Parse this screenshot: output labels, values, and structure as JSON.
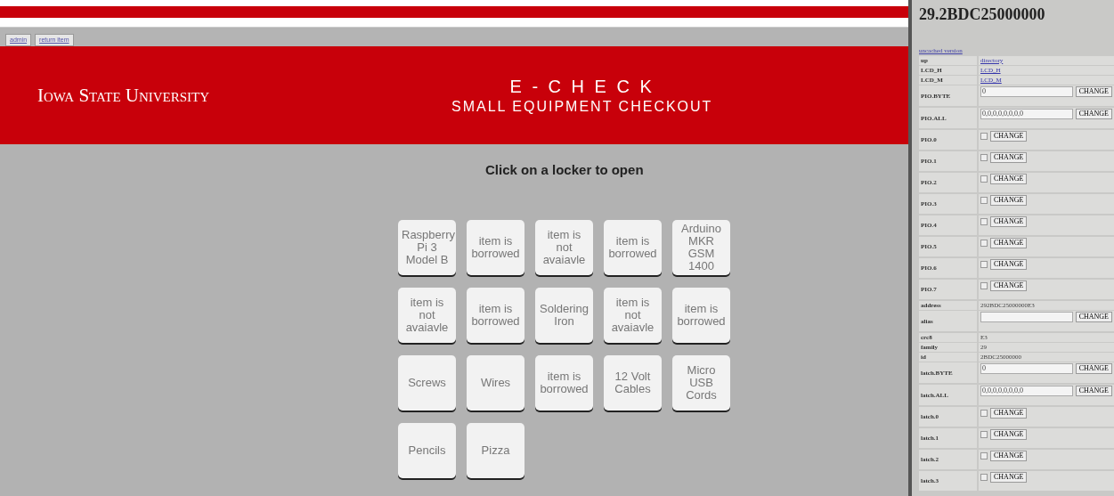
{
  "nav_tabs": [
    {
      "label": "admin"
    },
    {
      "label": "return item"
    }
  ],
  "header": {
    "logo": "Iowa State University",
    "title": "E - C H E C K",
    "subtitle": "SMALL EQUIPMENT CHECKOUT"
  },
  "instruction": "Click on a locker to open",
  "lockers": [
    {
      "label": "Raspberry Pi 3 Model B"
    },
    {
      "label": "item is borrowed"
    },
    {
      "label": "item is not avaiavle"
    },
    {
      "label": "item is borrowed"
    },
    {
      "label": "Arduino MKR GSM 1400"
    },
    {
      "label": "item is not avaiavle"
    },
    {
      "label": "item is borrowed"
    },
    {
      "label": "Soldering Iron"
    },
    {
      "label": "item is not avaiavle"
    },
    {
      "label": "item is borrowed"
    },
    {
      "label": "Screws"
    },
    {
      "label": "Wires"
    },
    {
      "label": "item is borrowed"
    },
    {
      "label": "12 Volt Cables"
    },
    {
      "label": "Micro USB Cords"
    },
    {
      "label": "Pencils"
    },
    {
      "label": "Pizza"
    }
  ],
  "device_panel": {
    "title": "29.2BDC25000000",
    "link": "uncached version",
    "rows": [
      {
        "kind": "link",
        "name": "up",
        "value": "directory"
      },
      {
        "kind": "link",
        "name": "LCD_H",
        "value": "LCD_H"
      },
      {
        "kind": "link",
        "name": "LCD_M",
        "value": "LCD_M"
      },
      {
        "kind": "field",
        "name": "PIO.BYTE",
        "value": "0",
        "button": "CHANGE"
      },
      {
        "kind": "field",
        "name": "PIO.ALL",
        "value": "0,0,0,0,0,0,0,0",
        "button": "CHANGE"
      },
      {
        "kind": "check",
        "name": "PIO.0",
        "checked": false,
        "button": "CHANGE"
      },
      {
        "kind": "check",
        "name": "PIO.1",
        "checked": false,
        "button": "CHANGE"
      },
      {
        "kind": "check",
        "name": "PIO.2",
        "checked": false,
        "button": "CHANGE"
      },
      {
        "kind": "check",
        "name": "PIO.3",
        "checked": false,
        "button": "CHANGE"
      },
      {
        "kind": "check",
        "name": "PIO.4",
        "checked": false,
        "button": "CHANGE"
      },
      {
        "kind": "check",
        "name": "PIO.5",
        "checked": false,
        "button": "CHANGE"
      },
      {
        "kind": "check",
        "name": "PIO.6",
        "checked": false,
        "button": "CHANGE"
      },
      {
        "kind": "check",
        "name": "PIO.7",
        "checked": false,
        "button": "CHANGE"
      },
      {
        "kind": "text",
        "name": "address",
        "value": "292BDC25000000E3"
      },
      {
        "kind": "field",
        "name": "alias",
        "value": "",
        "button": "CHANGE"
      },
      {
        "kind": "text",
        "name": "crc8",
        "value": "E3"
      },
      {
        "kind": "text",
        "name": "family",
        "value": "29"
      },
      {
        "kind": "text",
        "name": "id",
        "value": "2BDC25000000"
      },
      {
        "kind": "field",
        "name": "latch.BYTE",
        "value": "0",
        "button": "CHANGE"
      },
      {
        "kind": "field",
        "name": "latch.ALL",
        "value": "0,0,0,0,0,0,0,0",
        "button": "CHANGE"
      },
      {
        "kind": "check",
        "name": "latch.0",
        "checked": false,
        "button": "CHANGE"
      },
      {
        "kind": "check",
        "name": "latch.1",
        "checked": false,
        "button": "CHANGE"
      },
      {
        "kind": "check",
        "name": "latch.2",
        "checked": false,
        "button": "CHANGE"
      },
      {
        "kind": "check",
        "name": "latch.3",
        "checked": false,
        "button": "CHANGE"
      }
    ]
  }
}
